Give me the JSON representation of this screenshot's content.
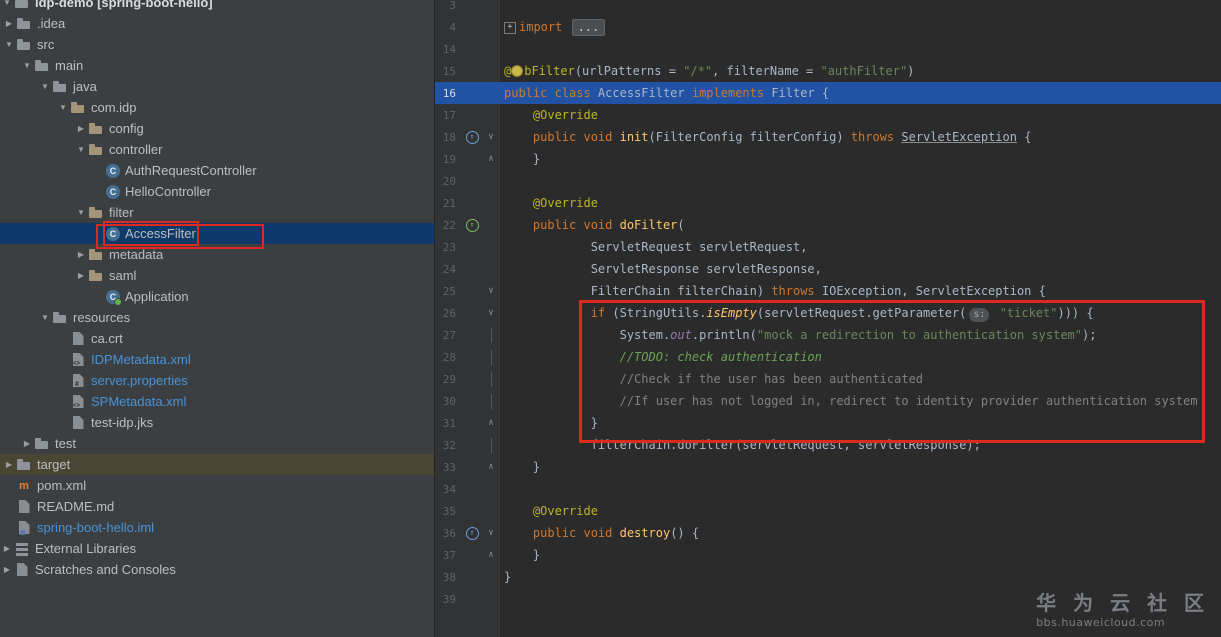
{
  "colors": {
    "editor_selection_blue": "#2152a3",
    "annotation_box_red": "#dc2a1f",
    "keyword_orange": "#cc7832",
    "string_green": "#6a8759",
    "annotation_yellow": "#bbb529",
    "tree_selected_blue": "#0d3a68",
    "tree_target_brown": "#4b4533",
    "blue_filename": "#4793d8"
  },
  "project_tree": {
    "items": [
      {
        "label": "idp-demo [spring-boot-hello]",
        "indent": 0,
        "arrow": "down",
        "icon": "folder",
        "bold": true
      },
      {
        "label": ".idea",
        "indent": 1,
        "arrow": "right",
        "icon": "folder"
      },
      {
        "label": "src",
        "indent": 1,
        "arrow": "down",
        "icon": "folder"
      },
      {
        "label": "main",
        "indent": 2,
        "arrow": "down",
        "icon": "folder"
      },
      {
        "label": "java",
        "indent": 3,
        "arrow": "down",
        "icon": "folder"
      },
      {
        "label": "com.idp",
        "indent": 4,
        "arrow": "down",
        "icon": "package"
      },
      {
        "label": "config",
        "indent": 5,
        "arrow": "right",
        "icon": "package"
      },
      {
        "label": "controller",
        "indent": 5,
        "arrow": "down",
        "icon": "package"
      },
      {
        "label": "AuthRequestController",
        "indent": 6,
        "icon": "class"
      },
      {
        "label": "HelloController",
        "indent": 6,
        "icon": "class"
      },
      {
        "label": "filter",
        "indent": 5,
        "arrow": "down",
        "icon": "package"
      },
      {
        "label": "AccessFilter",
        "indent": 6,
        "icon": "class",
        "selected": true,
        "redbox": true
      },
      {
        "label": "metadata",
        "indent": 5,
        "arrow": "right",
        "icon": "package"
      },
      {
        "label": "saml",
        "indent": 5,
        "arrow": "right",
        "icon": "package"
      },
      {
        "label": "Application",
        "indent": 6,
        "icon": "class-app"
      },
      {
        "label": "resources",
        "indent": 3,
        "arrow": "down",
        "icon": "folder"
      },
      {
        "label": "ca.crt",
        "indent": 4,
        "icon": "file"
      },
      {
        "label": "IDPMetadata.xml",
        "indent": 4,
        "icon": "file-xml",
        "color": "blue"
      },
      {
        "label": "server.properties",
        "indent": 4,
        "icon": "file-prop",
        "color": "blue"
      },
      {
        "label": "SPMetadata.xml",
        "indent": 4,
        "icon": "file-xml",
        "color": "blue"
      },
      {
        "label": "test-idp.jks",
        "indent": 4,
        "icon": "file"
      },
      {
        "label": "test",
        "indent": 2,
        "arrow": "right",
        "icon": "folder"
      },
      {
        "label": "target",
        "indent": 1,
        "arrow": "right",
        "icon": "folder",
        "highlight": true
      },
      {
        "label": "pom.xml",
        "indent": 1,
        "icon": "file-maven"
      },
      {
        "label": "README.md",
        "indent": 1,
        "icon": "file"
      },
      {
        "label": "spring-boot-hello.iml",
        "indent": 1,
        "icon": "file-iml",
        "color": "blue"
      },
      {
        "label": "External Libraries",
        "indent": 0,
        "arrow": "right",
        "icon": "lib"
      },
      {
        "label": "Scratches and Consoles",
        "indent": 0,
        "arrow": "right",
        "icon": "scratch"
      }
    ]
  },
  "editor": {
    "file": "AccessFilter",
    "lines": [
      {
        "n": "3",
        "segs": []
      },
      {
        "n": "4",
        "segs": [
          {
            "icon": "fold-expand"
          },
          {
            "t": "import ",
            "c": "kw"
          },
          {
            "t": "...",
            "c": "folded"
          }
        ]
      },
      {
        "n": "14",
        "segs": []
      },
      {
        "n": "15",
        "segs": [
          {
            "t": "@",
            "c": "ann"
          },
          {
            "icon": "bulb"
          },
          {
            "t": "bFilter",
            "c": "ann"
          },
          {
            "t": "(urlPatterns = ",
            "c": "def"
          },
          {
            "t": "\"/*\"",
            "c": "str"
          },
          {
            "t": ", filterName = ",
            "c": "def"
          },
          {
            "t": "\"authFilter\"",
            "c": "str"
          },
          {
            "t": ")",
            "c": "def"
          }
        ]
      },
      {
        "n": "16",
        "hl": true,
        "segs": [
          {
            "t": "public class ",
            "c": "kw"
          },
          {
            "t": "AccessFilter ",
            "c": "def"
          },
          {
            "t": "implements ",
            "c": "kw"
          },
          {
            "t": "Filter {",
            "c": "def"
          }
        ]
      },
      {
        "n": "17",
        "segs": [
          {
            "t": "    ",
            "c": "def"
          },
          {
            "t": "@Override",
            "c": "ann"
          }
        ]
      },
      {
        "n": "18",
        "ovr": "blue",
        "fold": "down",
        "segs": [
          {
            "t": "    ",
            "c": "def"
          },
          {
            "t": "public void ",
            "c": "kw"
          },
          {
            "t": "init",
            "c": "mth"
          },
          {
            "t": "(FilterConfig filterConfig) ",
            "c": "def"
          },
          {
            "t": "throws ",
            "c": "kw"
          },
          {
            "t": "ServletException",
            "c": "und"
          },
          {
            "t": " {",
            "c": "def"
          }
        ]
      },
      {
        "n": "19",
        "fold": "up",
        "segs": [
          {
            "t": "    }",
            "c": "def"
          }
        ]
      },
      {
        "n": "20",
        "segs": []
      },
      {
        "n": "21",
        "segs": [
          {
            "t": "    ",
            "c": "def"
          },
          {
            "t": "@Override",
            "c": "ann"
          }
        ]
      },
      {
        "n": "22",
        "ovr": "green",
        "segs": [
          {
            "t": "    ",
            "c": "def"
          },
          {
            "t": "public void ",
            "c": "kw"
          },
          {
            "t": "doFilter",
            "c": "mth"
          },
          {
            "t": "(",
            "c": "def"
          }
        ]
      },
      {
        "n": "23",
        "segs": [
          {
            "t": "            ServletRequest servletRequest,",
            "c": "def"
          }
        ]
      },
      {
        "n": "24",
        "segs": [
          {
            "t": "            ServletResponse servletResponse,",
            "c": "def"
          }
        ]
      },
      {
        "n": "25",
        "fold": "down",
        "segs": [
          {
            "t": "            FilterChain filterChain) ",
            "c": "def"
          },
          {
            "t": "throws ",
            "c": "kw"
          },
          {
            "t": "IOException, ServletException {",
            "c": "def"
          }
        ]
      },
      {
        "n": "26",
        "fold": "down",
        "segs": [
          {
            "t": "            ",
            "c": "def"
          },
          {
            "t": "if ",
            "c": "kw"
          },
          {
            "t": "(StringUtils.",
            "c": "def"
          },
          {
            "t": "isEmpty",
            "c": "mthi"
          },
          {
            "t": "(servletRequest.getParameter(",
            "c": "def"
          },
          {
            "inlay": "s:"
          },
          {
            "t": " ",
            "c": "def"
          },
          {
            "t": "\"ticket\"",
            "c": "str"
          },
          {
            "t": "))) {",
            "c": "def"
          }
        ]
      },
      {
        "n": "27",
        "fold": "bar",
        "segs": [
          {
            "t": "                System.",
            "c": "def"
          },
          {
            "t": "out",
            "c": "fld"
          },
          {
            "t": ".println(",
            "c": "def"
          },
          {
            "t": "\"mock a redirection to authentication system\"",
            "c": "str"
          },
          {
            "t": ");",
            "c": "def"
          }
        ]
      },
      {
        "n": "28",
        "fold": "bar",
        "segs": [
          {
            "t": "                ",
            "c": "def"
          },
          {
            "t": "//TODO: check authentication",
            "c": "todo"
          }
        ]
      },
      {
        "n": "29",
        "fold": "bar",
        "segs": [
          {
            "t": "                ",
            "c": "def"
          },
          {
            "t": "//Check if the user has been authenticated",
            "c": "cmt"
          }
        ]
      },
      {
        "n": "30",
        "fold": "bar",
        "segs": [
          {
            "t": "                ",
            "c": "def"
          },
          {
            "t": "//If user has not logged in, redirect to identity provider authentication system",
            "c": "cmt"
          }
        ]
      },
      {
        "n": "31",
        "fold": "up",
        "segs": [
          {
            "t": "            }",
            "c": "def"
          }
        ]
      },
      {
        "n": "32",
        "fold": "bar",
        "segs": [
          {
            "t": "            filterChain.doFilter(servletRequest, servletResponse);",
            "c": "def"
          }
        ]
      },
      {
        "n": "33",
        "fold": "up",
        "segs": [
          {
            "t": "    }",
            "c": "def"
          }
        ]
      },
      {
        "n": "34",
        "segs": []
      },
      {
        "n": "35",
        "segs": [
          {
            "t": "    ",
            "c": "def"
          },
          {
            "t": "@Override",
            "c": "ann"
          }
        ]
      },
      {
        "n": "36",
        "ovr": "blue",
        "fold": "down",
        "segs": [
          {
            "t": "    ",
            "c": "def"
          },
          {
            "t": "public void ",
            "c": "kw"
          },
          {
            "t": "destroy",
            "c": "mth"
          },
          {
            "t": "() {",
            "c": "def"
          }
        ]
      },
      {
        "n": "37",
        "fold": "up",
        "segs": [
          {
            "t": "    }",
            "c": "def"
          }
        ]
      },
      {
        "n": "38",
        "segs": [
          {
            "t": "}",
            "c": "def"
          }
        ]
      },
      {
        "n": "39",
        "segs": []
      }
    ]
  },
  "watermark": {
    "line1": "华 为 云 社 区",
    "line2": "bbs.huaweicloud.com"
  }
}
